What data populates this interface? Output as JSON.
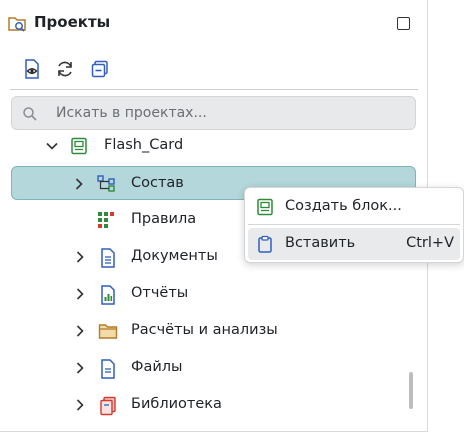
{
  "header": {
    "title": "Проекты",
    "icons": {
      "projects": "projects-folder-icon",
      "maximize": "maximize-icon"
    }
  },
  "toolbar": {
    "buttons": [
      {
        "name": "show-file-icon",
        "tooltip": ""
      },
      {
        "name": "refresh-icon",
        "tooltip": ""
      },
      {
        "name": "collapse-all-icon",
        "tooltip": ""
      }
    ]
  },
  "search": {
    "placeholder": "Искать в проектах..."
  },
  "tree": {
    "root": {
      "label": "Flash_Card",
      "icon": "board-icon",
      "expanded": true
    },
    "items": [
      {
        "label": "Состав",
        "icon": "structure-icon",
        "selected": true,
        "expandable": true
      },
      {
        "label": "Правила",
        "icon": "rules-icon",
        "expandable": false
      },
      {
        "label": "Документы",
        "icon": "documents-icon",
        "expandable": true
      },
      {
        "label": "Отчёты",
        "icon": "reports-icon",
        "expandable": true
      },
      {
        "label": "Расчёты и анализы",
        "icon": "folder-icon",
        "expandable": true
      },
      {
        "label": "Файлы",
        "icon": "file-icon",
        "expandable": true
      },
      {
        "label": "Библиотека",
        "icon": "library-icon",
        "expandable": true
      }
    ]
  },
  "context_menu": {
    "items": [
      {
        "label": "Создать блок...",
        "icon": "create-block-icon",
        "shortcut": ""
      },
      {
        "label": "Вставить",
        "icon": "paste-icon",
        "shortcut": "Ctrl+V",
        "hovered": true
      }
    ]
  },
  "colors": {
    "selection_bg": "#b3d7da",
    "selection_border": "#7fb6bb",
    "search_bg": "#e8e9ea",
    "icon_blue": "#2f5fbf",
    "icon_green": "#2e8b3a",
    "menu_hover": "#e9eaeb"
  }
}
